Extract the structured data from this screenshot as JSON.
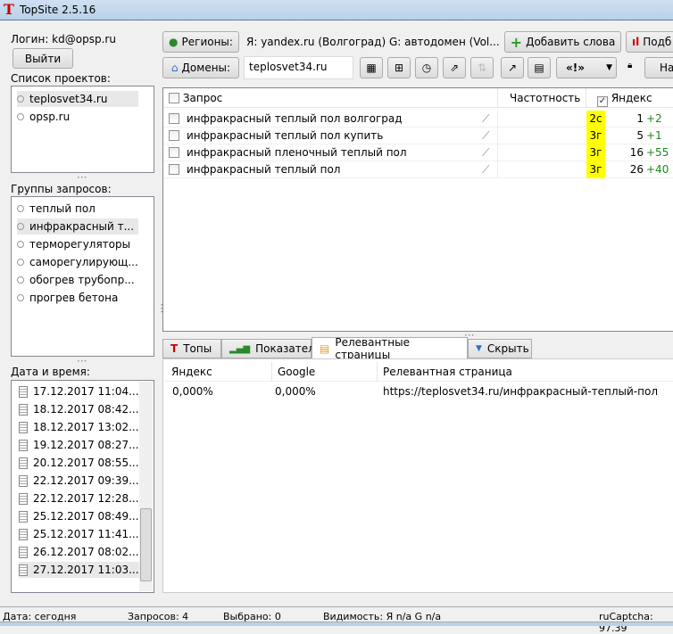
{
  "window": {
    "title": "TopSite 2.5.16"
  },
  "left": {
    "login": "Логин: kd@opsp.ru",
    "logout": "Выйти",
    "projects_label": "Список проектов:",
    "projects": [
      "teplosvet34.ru",
      "opsp.ru"
    ],
    "groups_label": "Группы запросов:",
    "groups": [
      "теплый пол",
      "инфракрасный т...",
      "терморегуляторы",
      "саморегулирующ...",
      "обогрев трубопр...",
      "прогрев бетона"
    ],
    "dates_label": "Дата и время:",
    "dates": [
      "17.12.2017 11:04...",
      "18.12.2017 08:42...",
      "18.12.2017 13:02...",
      "19.12.2017 08:27...",
      "20.12.2017 08:55...",
      "22.12.2017 09:39...",
      "22.12.2017 12:28...",
      "25.12.2017 08:49...",
      "25.12.2017 11:41...",
      "26.12.2017 08:02...",
      "27.12.2017 11:03..."
    ]
  },
  "toolbar": {
    "regions": "Регионы:",
    "regions_text": "Я: yandex.ru (Волгоград)  G: автодомен (Vol...",
    "add_words": "Добавить слова",
    "podbor": "Подб",
    "domains": "Домены:",
    "domain_value": "teplosvet34.ru",
    "quote_btn": "«!»",
    "na": "На"
  },
  "table": {
    "headers": {
      "query": "Запрос",
      "freq": "Частотность",
      "yandex": "Яндекс"
    },
    "rows": [
      {
        "query": "инфракрасный теплый пол волгоград",
        "badge": "2с",
        "pos": "1",
        "delta": "+2"
      },
      {
        "query": "инфракрасный теплый пол купить",
        "badge": "3г",
        "pos": "5",
        "delta": "+1"
      },
      {
        "query": "инфракрасный пленочный теплый пол",
        "badge": "3г",
        "pos": "16",
        "delta": "+55"
      },
      {
        "query": "инфракрасный теплый пол",
        "badge": "3г",
        "pos": "26",
        "delta": "+40"
      }
    ]
  },
  "tabs": [
    "Топы",
    "Показатели",
    "Релевантные страницы",
    "Скрыть"
  ],
  "relevant": {
    "headers": [
      "Яндекс",
      "Google",
      "Релевантная страница"
    ],
    "rows": [
      [
        "0,000%",
        "0,000%",
        "https://teplosvet34.ru/инфракрасный-теплый-пол"
      ]
    ]
  },
  "status": {
    "date": "Дата: сегодня",
    "queries": "Запросов: 4",
    "selected": "Выбрано: 0",
    "visibility": "Видимость:  Я n/a  G n/a",
    "captcha": "ruCaptcha: 97.39"
  },
  "colors": {
    "badge": "#ffff00",
    "delta": "#1a8a1a",
    "brand": "#cc0000"
  }
}
